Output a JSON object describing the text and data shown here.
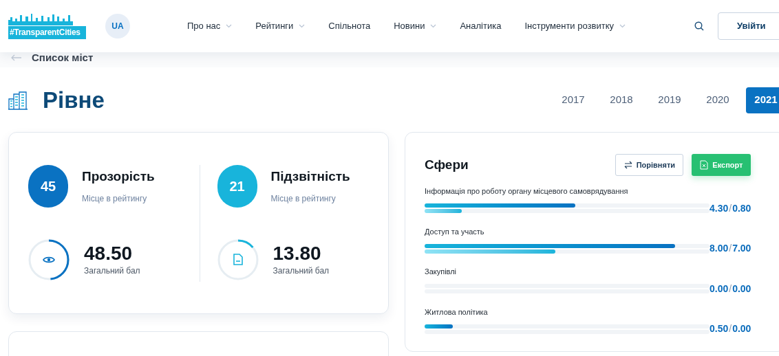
{
  "header": {
    "logo_text": "#TransparentCities",
    "language": "UA",
    "nav": [
      {
        "label": "Про нас",
        "dropdown": true
      },
      {
        "label": "Рейтинги",
        "dropdown": true
      },
      {
        "label": "Спільнота",
        "dropdown": false
      },
      {
        "label": "Новини",
        "dropdown": true
      },
      {
        "label": "Аналітика",
        "dropdown": false
      },
      {
        "label": "Інструменти розвитку",
        "dropdown": true
      }
    ],
    "login": "Увійти"
  },
  "breadcrumb": "Список міст",
  "city": "Рівне",
  "years": [
    {
      "label": "2017",
      "selected": false
    },
    {
      "label": "2018",
      "selected": false
    },
    {
      "label": "2019",
      "selected": false
    },
    {
      "label": "2020",
      "selected": false
    },
    {
      "label": "2021",
      "selected": true
    }
  ],
  "ratings": [
    {
      "kind": "transparency",
      "rank": "45",
      "title": "Прозорість",
      "subtitle": "Місце в рейтингу",
      "score": "48.50",
      "score_label": "Загальний бал",
      "level": 0.485,
      "color": "#0a72c2"
    },
    {
      "kind": "accountability",
      "rank": "21",
      "title": "Підзвітність",
      "subtitle": "Місце в рейтингу",
      "score": "13.80",
      "score_label": "Загальний бал",
      "level": 0.138,
      "color": "#18b4db"
    }
  ],
  "spheres": {
    "title": "Сфери",
    "compare": "Порівняти",
    "export": "Експорт",
    "items": [
      {
        "name": "Інформація про роботу органу місцевого самоврядування",
        "primary": "4.30",
        "separator": "/",
        "secondary": "0.80",
        "bars": [
          {
            "level": 0.53
          },
          {
            "level": 0.13
          }
        ]
      },
      {
        "name": "Доступ та участь",
        "primary": "8.00",
        "separator": "/",
        "secondary": "7.00",
        "bars": [
          {
            "level": 0.88
          },
          {
            "level": 0.46
          }
        ]
      },
      {
        "name": "Закупівлі",
        "primary": "0.00",
        "separator": "/",
        "secondary": "0.00",
        "bars": [
          {
            "level": 0
          },
          {
            "level": 0
          }
        ]
      },
      {
        "name": "Житлова політика",
        "primary": "0.50",
        "separator": "/",
        "secondary": "0.00",
        "bars": [
          {
            "level": 0.1
          },
          {
            "level": 0
          }
        ]
      }
    ]
  }
}
